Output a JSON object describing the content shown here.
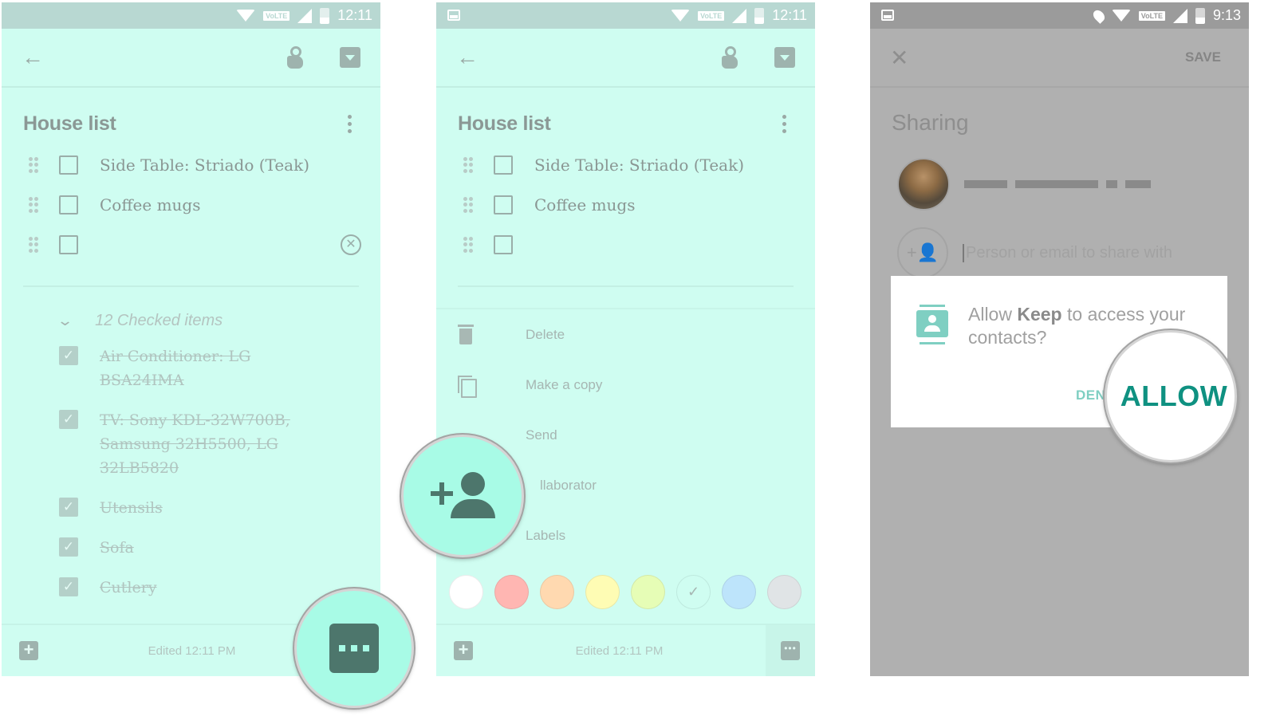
{
  "screens": [
    {
      "status": {
        "time": "12:11",
        "network": "VoLTE"
      },
      "appbar": {
        "back_icon": "arrow-left-icon",
        "reminder_icon": "hand-pointer-icon",
        "archive_icon": "archive-icon"
      },
      "note": {
        "title": "House list",
        "items": [
          {
            "text": "Side Table: Striado (Teak)",
            "checked": false
          },
          {
            "text": "Coffee mugs",
            "checked": false
          },
          {
            "text": "",
            "checked": false
          }
        ],
        "checked_header": "12 Checked items",
        "checked_items": [
          "Air Conditioner: LG BSA24IMA",
          "TV: Sony KDL-32W700B, Samsung 32H5500, LG 32LB5820",
          "Utensils",
          "Sofa",
          "Cutlery"
        ]
      },
      "bottombar": {
        "edited": "Edited 12:11 PM",
        "add_icon": "plus-box-icon",
        "more_icon": "more-horizontal-icon"
      },
      "magnifier": {
        "icon": "more-horizontal-icon",
        "label": "More options (magnified)"
      }
    },
    {
      "status": {
        "time": "12:11",
        "network": "VoLTE"
      },
      "note": {
        "title": "House list",
        "items": [
          {
            "text": "Side Table: Striado (Teak)",
            "checked": false
          },
          {
            "text": "Coffee mugs",
            "checked": false
          },
          {
            "text": "",
            "checked": false
          }
        ]
      },
      "menu": [
        {
          "label": "Delete",
          "icon": "trash-icon"
        },
        {
          "label": "Make a copy",
          "icon": "copy-icon"
        },
        {
          "label": "Send",
          "icon": "send-icon"
        },
        {
          "label": "Collaborator",
          "visible_label": "llaborator",
          "icon": "add-person-icon"
        },
        {
          "label": "Labels",
          "icon": "label-icon"
        }
      ],
      "colors": [
        "#ffffff",
        "#ffb6b2",
        "#ffd9b0",
        "#fefcb4",
        "#e6fdb6",
        "#cffdf1",
        "#bde4fb",
        "#e0e4e6"
      ],
      "selected_color_index": 5,
      "bottombar": {
        "edited": "Edited 12:11 PM"
      },
      "magnifier": {
        "icon": "add-person-icon",
        "label": "Collaborator (magnified)"
      }
    },
    {
      "status": {
        "time": "9:13",
        "network": "VoLTE"
      },
      "appbar": {
        "close_icon": "close-icon",
        "save_label": "SAVE"
      },
      "title": "Sharing",
      "owner": {
        "avatar": "avatar",
        "name_redacted": true
      },
      "share_input": {
        "placeholder": "Person or email to share with",
        "value": ""
      },
      "dialog": {
        "text_pre": "Allow ",
        "app_name": "Keep",
        "text_post": " to access your contacts?",
        "deny_label": "DENY",
        "deny_visible": "DEN",
        "allow_label": "ALLOW",
        "accent": "#0f9181"
      }
    }
  ]
}
